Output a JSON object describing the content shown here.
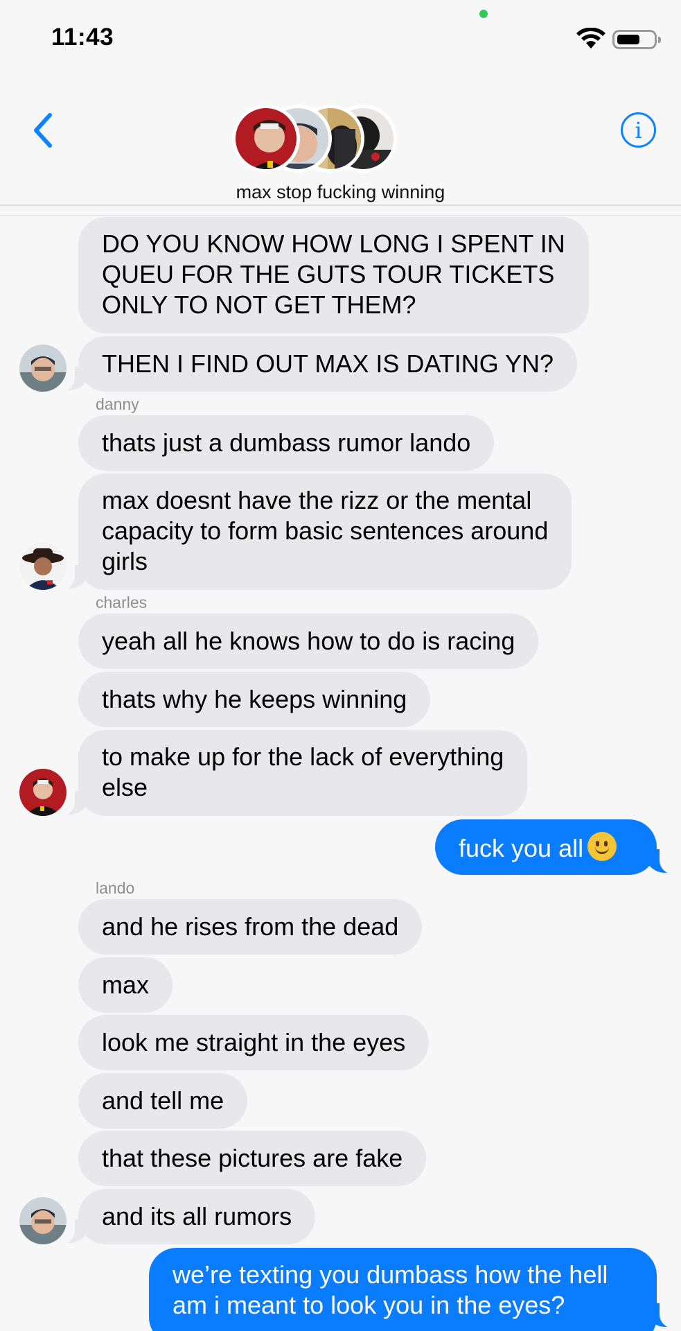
{
  "status": {
    "time": "11:43"
  },
  "header": {
    "group_name": "max stop fucking winning"
  },
  "messages": {
    "m1": "DO YOU KNOW HOW LONG I SPENT IN\nQUEU FOR THE GUTS TOUR TICKETS\nONLY TO NOT GET THEM?",
    "m2": "THEN I FIND OUT MAX IS DATING YN?",
    "sender_danny": "danny",
    "m3": "thats just a dumbass rumor lando",
    "m4": "max doesnt have the rizz or the mental\ncapacity to form basic sentences around\ngirls",
    "sender_charles": "charles",
    "m5": "yeah all he knows how to do is racing",
    "m6": "thats why he keeps winning",
    "m7": "to make up for the lack of everything\nelse",
    "m8": "fuck you all",
    "sender_lando": "lando",
    "m9": "and he rises from the dead",
    "m10": "max",
    "m11": "look me straight in the eyes",
    "m12": "and tell me",
    "m13": "that these pictures are fake",
    "m14": "and its all rumors",
    "m15": "we’re texting you dumbass how the hell\nam i meant to look you in the eyes?"
  },
  "colors": {
    "accent": "#0a84ff",
    "outgoing_bubble": "#0a7cff",
    "incoming_bubble": "#e8e7ec",
    "background": "#f7f7f7"
  },
  "icons": [
    "wifi-icon",
    "battery-icon",
    "back-chevron-icon",
    "info-icon",
    "slightly-smiling-face-emoji"
  ]
}
